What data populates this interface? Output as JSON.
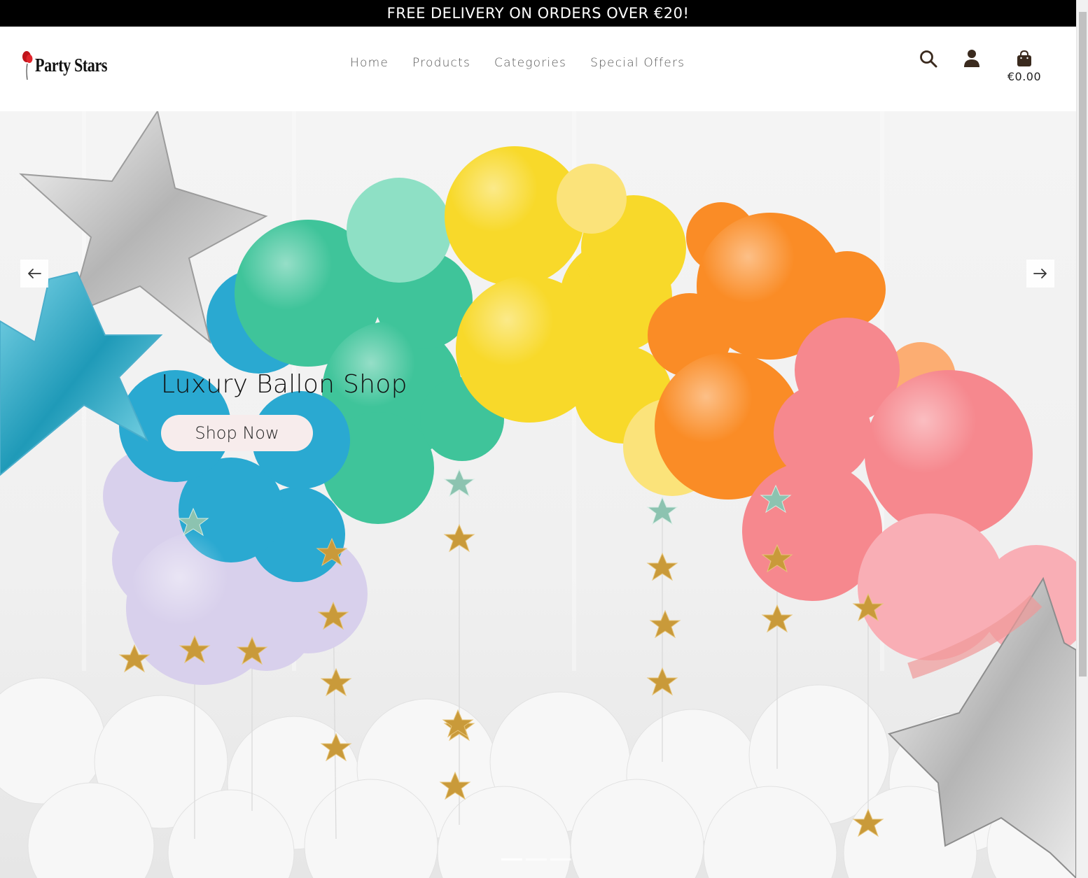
{
  "announcement": {
    "text": "FREE DELIVERY ON ORDERS OVER €20!"
  },
  "header": {
    "logo_text": "Party Stars",
    "nav": [
      {
        "label": "Home"
      },
      {
        "label": "Products"
      },
      {
        "label": "Categories"
      },
      {
        "label": "Special Offers"
      }
    ],
    "icons": {
      "search": "search-icon",
      "account": "user-icon",
      "cart": "shopping-bag-icon"
    },
    "cart_total": "€0.00"
  },
  "hero": {
    "title": "Luxury Ballon Shop",
    "button_label": "Shop Now",
    "slides_count": 3,
    "active_slide": 1,
    "icons": {
      "prev": "arrow-left-icon",
      "next": "arrow-right-icon"
    }
  },
  "colors": {
    "announcement_bg": "#000000",
    "announcement_text": "#ffffff",
    "nav_text": "#555555",
    "button_bg": "#f7ecec",
    "icon_dark": "#3a2a1e"
  }
}
